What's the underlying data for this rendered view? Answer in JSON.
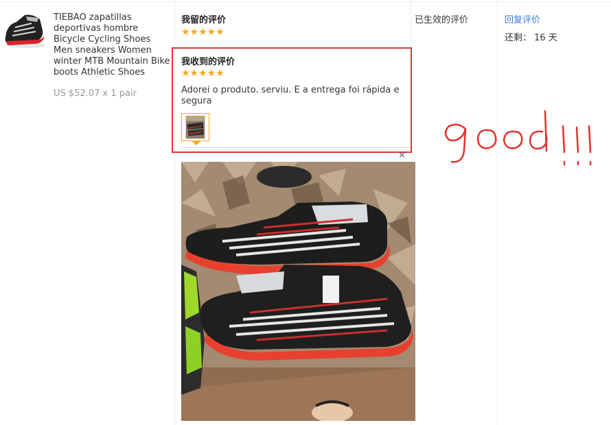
{
  "product": {
    "title": "TIEBAO zapatillas deportivas hombre Bicycle Cycling Shoes Men sneakers Women winter MTB Mountain Bike boots Athletic Shoes",
    "price": "US $52.07 x 1 pair"
  },
  "my_review": {
    "heading": "我留的评价",
    "stars": "★★★★★",
    "rating": 5
  },
  "received_review": {
    "heading": "我收到的评价",
    "stars": "★★★★★",
    "rating": 5,
    "text": "Adorei o produto. serviu. E a entrega foi rápida e segura"
  },
  "status": {
    "label": "已生效的评价"
  },
  "actions": {
    "reply_label": "回复评价",
    "remaining_label": "还剩：",
    "remaining_value": "16 天"
  },
  "preview": {
    "close_icon": "×"
  },
  "annotation": {
    "handwritten": "good!!!"
  },
  "colors": {
    "star": "#f5a623",
    "highlight_border": "#d73838",
    "link": "#3a7bd5",
    "annotation": "#e0322b"
  }
}
